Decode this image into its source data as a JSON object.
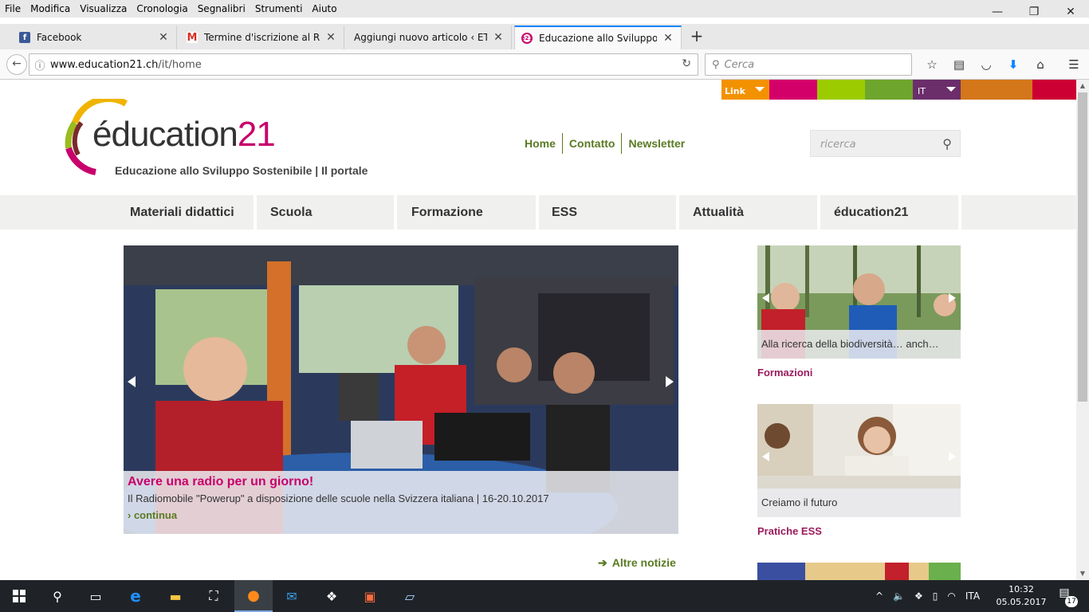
{
  "menubar": {
    "items": [
      "File",
      "Modifica",
      "Visualizza",
      "Cronologia",
      "Segnalibri",
      "Strumenti",
      "Aiuto"
    ]
  },
  "tabs": [
    {
      "title": "Facebook",
      "icon": "facebook-icon"
    },
    {
      "title": "Termine d'iscrizione al Radio",
      "icon": "gmail-icon"
    },
    {
      "title": "Aggiungi nuovo articolo ‹ ETiCin",
      "icon": "none"
    },
    {
      "title": "Educazione allo Sviluppo So",
      "icon": "education21-icon"
    }
  ],
  "urlbar": {
    "domain": "www.education21.ch",
    "path": "/it/home"
  },
  "browser_search": {
    "placeholder": "Cerca"
  },
  "colorbar": {
    "link_label": "Link",
    "lang_label": "IT",
    "colors": [
      "#d4006a",
      "#9ccc00",
      "#6ea52c",
      "#d4771a",
      "#cc0033"
    ]
  },
  "logo": {
    "text_main": "éducation",
    "text_num": "21",
    "subtitle": "Educazione allo Sviluppo Sostenibile | Il portale"
  },
  "top_links": [
    "Home",
    "Contatto",
    "Newsletter"
  ],
  "site_search": {
    "placeholder": "ricerca"
  },
  "mainnav": [
    "Materiali didattici",
    "Scuola",
    "Formazione",
    "ESS",
    "Attualità",
    "éducation21"
  ],
  "hero": {
    "title": "Avere una radio per un giorno!",
    "subtitle": "Il Radiomobile \"Powerup\" a disposizione delle scuole nella Svizzera italiana | 16-20.10.2017",
    "more": "› continua"
  },
  "altre_notizie": "Altre notizie",
  "side_cards": [
    {
      "caption": "Alla ricerca della biodiversità… anch…",
      "label": "Formazioni"
    },
    {
      "caption": "Creiamo il futuro",
      "label": "Pratiche ESS"
    }
  ],
  "taskbar": {
    "lang": "ITA",
    "time": "10:32",
    "date": "05.05.2017",
    "notifications": "17"
  }
}
